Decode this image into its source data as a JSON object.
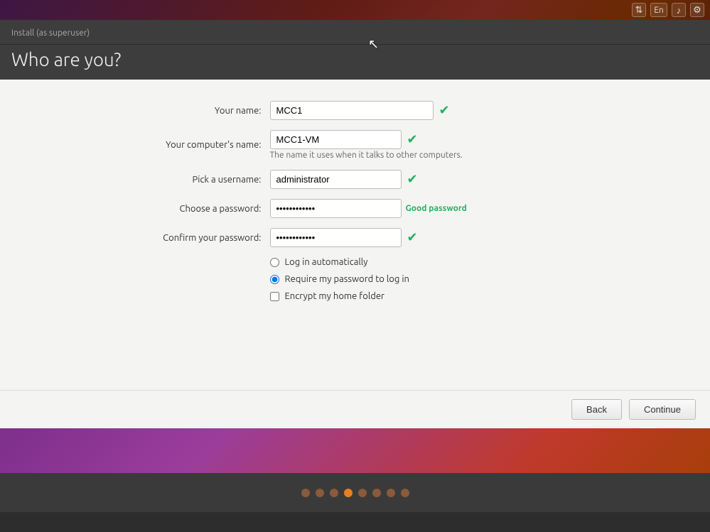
{
  "topbar": {
    "icons": [
      "transfer-icon",
      "language-icon",
      "volume-icon",
      "settings-icon"
    ],
    "language_label": "En"
  },
  "installer": {
    "subtitle": "Install (as superuser)",
    "title": "Who are you?",
    "form": {
      "your_name_label": "Your name:",
      "your_name_value": "MCC1",
      "computer_name_label": "Your computer's name:",
      "computer_name_value": "MCC1-VM",
      "computer_name_hint": "The name it uses when it talks to other computers.",
      "username_label": "Pick a username:",
      "username_value": "administrator",
      "password_label": "Choose a password:",
      "password_value": "••••••••••••",
      "password_strength": "Good password",
      "confirm_password_label": "Confirm your password:",
      "confirm_password_value": "••••••••••••",
      "login_auto_label": "Log in automatically",
      "require_password_label": "Require my password to log in",
      "encrypt_home_label": "Encrypt my home folder"
    },
    "footer": {
      "back_label": "Back",
      "continue_label": "Continue"
    }
  },
  "progress": {
    "dots": [
      {
        "active": false
      },
      {
        "active": false
      },
      {
        "active": false
      },
      {
        "active": true
      },
      {
        "active": false
      },
      {
        "active": false
      },
      {
        "active": false
      },
      {
        "active": false
      }
    ]
  }
}
